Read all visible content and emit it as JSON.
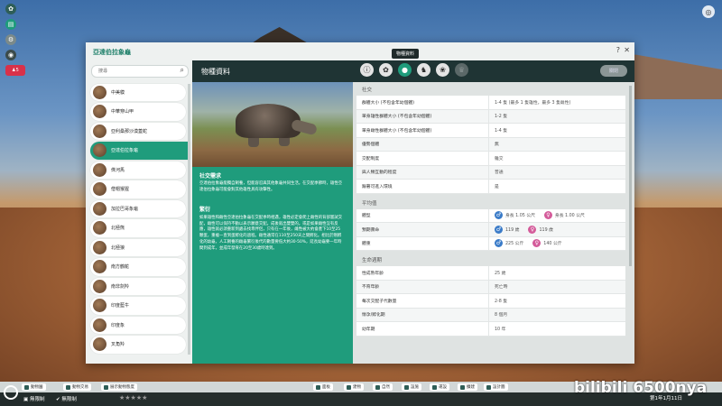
{
  "sidebar_badge": "5",
  "dialog": {
    "title": "亞達伯拉象龜",
    "help": "?",
    "close": "✕",
    "tooltip": "物種資料"
  },
  "search": {
    "placeholder": "搜尋"
  },
  "species": [
    {
      "name": "中美貘",
      "selected": false
    },
    {
      "name": "中華穿山甲",
      "selected": false
    },
    {
      "name": "亞利桑那沙漠蓋蛇",
      "selected": false
    },
    {
      "name": "亞達伯拉象龜",
      "selected": true
    },
    {
      "name": "侏河馬",
      "selected": false
    },
    {
      "name": "僧帽猴猩",
      "selected": false
    },
    {
      "name": "加拉巴哥象龜",
      "selected": false
    },
    {
      "name": "北極熊",
      "selected": false
    },
    {
      "name": "北極狼",
      "selected": false
    },
    {
      "name": "南方鶴鴕",
      "selected": false
    },
    {
      "name": "南非劍羚",
      "selected": false
    },
    {
      "name": "印度藍牛",
      "selected": false
    },
    {
      "name": "印度象",
      "selected": false
    },
    {
      "name": "叉角羚",
      "selected": false
    }
  ],
  "header": {
    "title": "物種資料",
    "tabs": [
      {
        "icon": "info-icon",
        "glyph": "ⓘ",
        "active": false,
        "disabled": false
      },
      {
        "icon": "habitat-icon",
        "glyph": "✿",
        "active": false,
        "disabled": false
      },
      {
        "icon": "food-icon",
        "glyph": "●",
        "active": true,
        "disabled": false
      },
      {
        "icon": "animal-icon",
        "glyph": "♞",
        "active": false,
        "disabled": false
      },
      {
        "icon": "paw-icon",
        "glyph": "❀",
        "active": false,
        "disabled": false
      },
      {
        "icon": "trophy-icon",
        "glyph": "♛",
        "active": false,
        "disabled": true
      }
    ],
    "badge": "關閉"
  },
  "description": {
    "heading1": "社交需求",
    "body1": "亞達伯拉象龜能獨自飼養，但能容忍與其他象龜共同生活。在交配季節時，雄性亞達伯拉象龜可能會對其他雄性具有攻擊性。",
    "heading2": "繁衍",
    "body2": "如果雄性和雌性亞達伯拉象龜在交配季時相遇，雄性必定會爬上雌性的背部嘗試交配，雌性可以保持不動以表示願意交配。成後就出雙雙的。或是如果雌性沒有反應，雄性就必須重新到處去找尋伴侶，只有在一年後，雌性被大約會產下10至25顆蛋，重複一直到蛋孵化的過程。雌性通常在110至250天之間孵化。相比於剛孵化的幼龜，人工飼養的雌龜繁衍後代的數量要低大約30-50%，延長幼龜要一年時間到成年，並成年發育在20至30歲時達到。"
  },
  "sections": {
    "social": {
      "title": "社交",
      "rows": [
        {
          "k": "群體大小 (不包含年幼個體)",
          "v": "1-4 隻 (最多 1 隻雄性，最多 3 隻雌性)"
        },
        {
          "k": "單身雄性群體大小 (不包含年幼個體)",
          "v": "1-2 隻"
        },
        {
          "k": "單身雌性群體大小 (不包含年幼個體)",
          "v": "1-4 隻"
        },
        {
          "k": "優勢個體",
          "v": "無"
        },
        {
          "k": "交配制度",
          "v": "雜交"
        },
        {
          "k": "與人類互動的程度",
          "v": "普通"
        },
        {
          "k": "跟著可進入環境",
          "v": "是"
        }
      ]
    },
    "average": {
      "title": "平均值",
      "rows": [
        {
          "k": "體型",
          "male": "身長 1.05 公尺",
          "female": "身長 1.00 公尺"
        },
        {
          "k": "預期壽命",
          "male": "119 歲",
          "female": "119 歲"
        },
        {
          "k": "體重",
          "male": "225 公斤",
          "female": "140 公斤"
        }
      ]
    },
    "life": {
      "title": "生命週期",
      "rows": [
        {
          "k": "性成熟年齡",
          "v": "25 歲"
        },
        {
          "k": "不育年齡",
          "v": "死亡時"
        },
        {
          "k": "每次交配子代數量",
          "v": "2-8 隻"
        },
        {
          "k": "懷孕/孵化期",
          "v": "8 個月"
        },
        {
          "k": "幼年期",
          "v": "10 年"
        }
      ]
    }
  },
  "bottom": {
    "tabs": [
      "動物園",
      "動物交易",
      "展示動物態度"
    ],
    "center_tabs": [
      "面板",
      "建物",
      "自然",
      "設施",
      "運設",
      "擴建",
      "設計圖"
    ],
    "status_left": "無限制",
    "status_money": "無限制",
    "watermark": "bilibili 6500nya",
    "date": "第1年1月11日"
  }
}
